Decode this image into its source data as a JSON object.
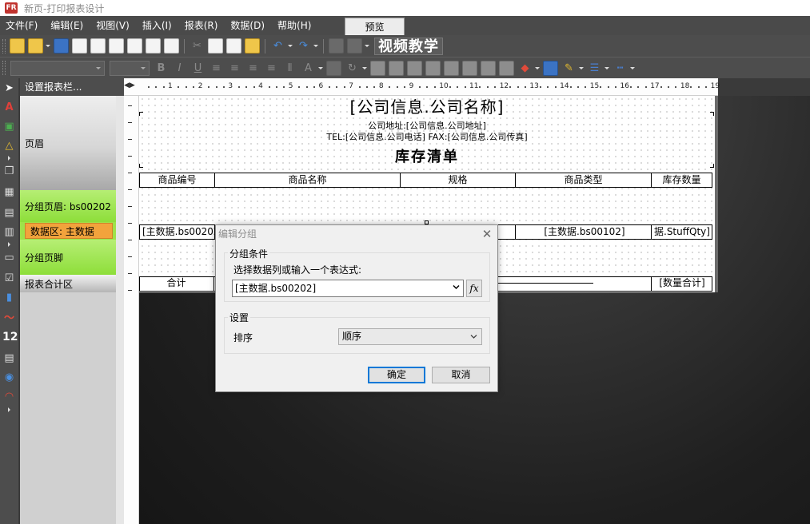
{
  "window": {
    "title": "新页-打印报表设计",
    "app_icon": "FR"
  },
  "menu": {
    "items": [
      "文件(F)",
      "编辑(E)",
      "视图(V)",
      "插入(I)",
      "报表(R)",
      "数据(D)",
      "帮助(H)"
    ],
    "preview_tab": "预览"
  },
  "toolbar": {
    "video_banner": "视频教学"
  },
  "left_tools": {
    "number_tool_label": "12"
  },
  "band_panel": {
    "header": "设置报表栏...",
    "bands": {
      "page_header": "页眉",
      "group_header": "分组页眉: bs00202",
      "data": "数据区: 主数据",
      "group_footer": "分组页脚",
      "summary": "报表合计区"
    }
  },
  "ruler": {
    "numbers": [
      "1",
      "2",
      "3",
      "4",
      "5",
      "6",
      "7",
      "8",
      "9",
      "10",
      "11",
      "12",
      "13",
      "14",
      "15",
      "16",
      "17",
      "18",
      "19"
    ]
  },
  "report": {
    "company_name": "[公司信息.公司名称]",
    "company_address": "公司地址:[公司信息.公司地址]",
    "company_contact": "TEL:[公司信息.公司电话]  FAX:[公司信息.公司传真]",
    "title": "库存清单",
    "columns": [
      "商品编号",
      "商品名称",
      "规格",
      "商品类型",
      "库存数量"
    ],
    "data_row": [
      "[主数据.bs00202]",
      "",
      "",
      "[主数据.bs00102]",
      "据.StuffQty]"
    ],
    "summary_label": "合计",
    "summary_value": "[数量合计]"
  },
  "dialog": {
    "title": "编辑分组",
    "group_condition_legend": "分组条件",
    "expression_prompt": "选择数据列或输入一个表达式:",
    "expression_value": "[主数据.bs00202]",
    "fx_label": "fx",
    "settings_legend": "设置",
    "sort_label": "排序",
    "sort_value": "顺序",
    "ok_label": "确定",
    "cancel_label": "取消"
  }
}
